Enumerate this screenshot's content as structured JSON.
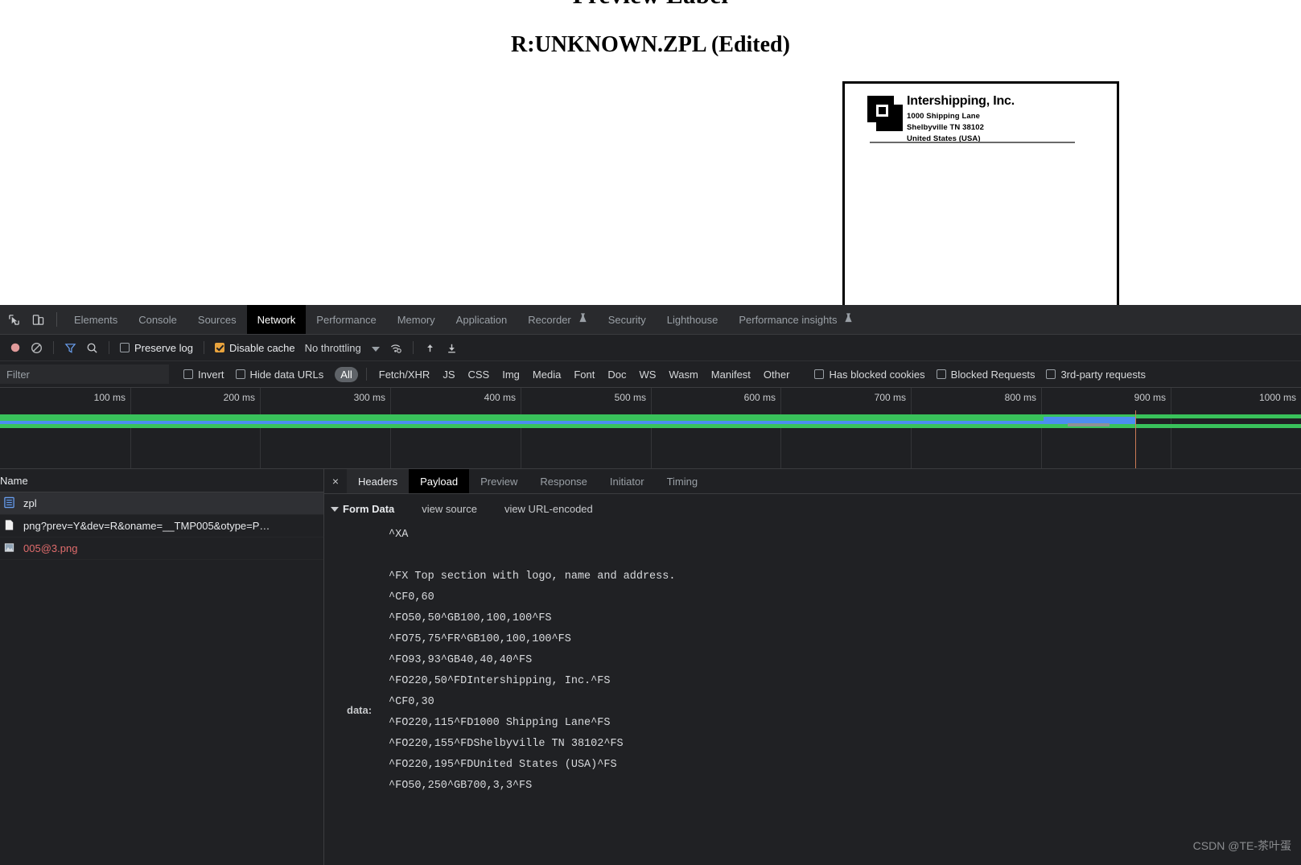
{
  "page": {
    "preview_title": "Preview Label",
    "file_title": "R:UNKNOWN.ZPL (Edited)",
    "label": {
      "company": "Intershipping, Inc.",
      "address_line1": "1000 Shipping Lane",
      "address_line2": "Shelbyville TN 38102",
      "address_line3": "United States (USA)"
    }
  },
  "devtools": {
    "tabs": [
      {
        "label": "Elements",
        "active": false,
        "experimental": false
      },
      {
        "label": "Console",
        "active": false,
        "experimental": false
      },
      {
        "label": "Sources",
        "active": false,
        "experimental": false
      },
      {
        "label": "Network",
        "active": true,
        "experimental": false
      },
      {
        "label": "Performance",
        "active": false,
        "experimental": false
      },
      {
        "label": "Memory",
        "active": false,
        "experimental": false
      },
      {
        "label": "Application",
        "active": false,
        "experimental": false
      },
      {
        "label": "Recorder",
        "active": false,
        "experimental": true
      },
      {
        "label": "Security",
        "active": false,
        "experimental": false
      },
      {
        "label": "Lighthouse",
        "active": false,
        "experimental": false
      },
      {
        "label": "Performance insights",
        "active": false,
        "experimental": true
      }
    ],
    "controls": {
      "preserve_log_label": "Preserve log",
      "preserve_log_checked": false,
      "disable_cache_label": "Disable cache",
      "disable_cache_checked": true,
      "throttling_value": "No throttling"
    },
    "filterbar": {
      "filter_placeholder": "Filter",
      "filter_value": "",
      "invert_label": "Invert",
      "invert_checked": false,
      "hide_data_urls_label": "Hide data URLs",
      "hide_data_urls_checked": false,
      "types": [
        "All",
        "Fetch/XHR",
        "JS",
        "CSS",
        "Img",
        "Media",
        "Font",
        "Doc",
        "WS",
        "Wasm",
        "Manifest",
        "Other"
      ],
      "active_type": "All",
      "has_blocked_cookies_label": "Has blocked cookies",
      "has_blocked_cookies_checked": false,
      "blocked_requests_label": "Blocked Requests",
      "blocked_requests_checked": false,
      "third_party_label": "3rd-party requests",
      "third_party_checked": false
    },
    "timeline": {
      "ticks": [
        "100 ms",
        "200 ms",
        "300 ms",
        "400 ms",
        "500 ms",
        "600 ms",
        "700 ms",
        "800 ms",
        "900 ms",
        "1000 ms"
      ]
    },
    "requests": {
      "column_name": "Name",
      "rows": [
        {
          "name": "zpl",
          "type": "document",
          "selected": true,
          "error": false
        },
        {
          "name": "png?prev=Y&dev=R&oname=__TMP005&otype=P…",
          "type": "file",
          "selected": false,
          "error": false
        },
        {
          "name": "005@3.png",
          "type": "image",
          "selected": false,
          "error": true
        }
      ]
    },
    "detail": {
      "tabs": [
        {
          "label": "Headers",
          "active": false,
          "semi": true
        },
        {
          "label": "Payload",
          "active": true,
          "semi": false
        },
        {
          "label": "Preview",
          "active": false,
          "semi": false
        },
        {
          "label": "Response",
          "active": false,
          "semi": false
        },
        {
          "label": "Initiator",
          "active": false,
          "semi": false
        },
        {
          "label": "Timing",
          "active": false,
          "semi": false
        }
      ],
      "close_glyph": "×",
      "form_data_title": "Form Data",
      "view_source_label": "view source",
      "view_url_encoded_label": "view URL-encoded",
      "data_key": "data:",
      "payload_lines": "^XA\n\n^FX Top section with logo, name and address.\n^CF0,60\n^FO50,50^GB100,100,100^FS\n^FO75,75^FR^GB100,100,100^FS\n^FO93,93^GB40,40,40^FS\n^FO220,50^FDIntershipping, Inc.^FS\n^CF0,30\n^FO220,115^FD1000 Shipping Lane^FS\n^FO220,155^FDShelbyville TN 38102^FS\n^FO220,195^FDUnited States (USA)^FS\n^FO50,250^GB700,3,3^FS"
    },
    "watermark": "CSDN @TE-茶叶蛋",
    "colors": {
      "accent_blue": "#4b8ef0",
      "green": "#39c25b",
      "error_red": "#e06c6c",
      "checkbox_orange": "#e8a33d"
    }
  }
}
